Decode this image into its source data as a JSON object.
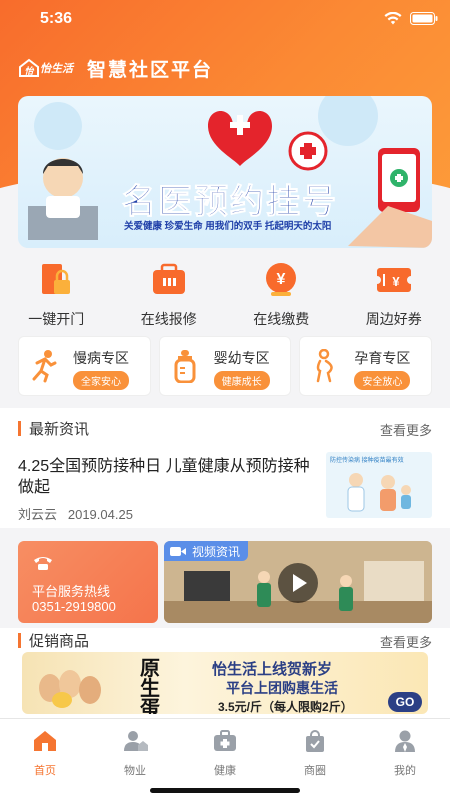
{
  "status": {
    "time": "5:36"
  },
  "app": {
    "logo_text": "怡生活",
    "title": "智慧社区平台"
  },
  "banner": {
    "headline": "名医预约挂号",
    "tagline": "关爱健康  珍爱生命  用我们的双手  托起明天的太阳"
  },
  "quick_actions": [
    {
      "label": "一键开门",
      "icon": "door-lock-icon"
    },
    {
      "label": "在线报修",
      "icon": "toolbox-icon"
    },
    {
      "label": "在线缴费",
      "icon": "yuan-coin-icon"
    },
    {
      "label": "周边好券",
      "icon": "coupon-icon"
    }
  ],
  "zones": [
    {
      "title": "慢病专区",
      "badge": "全家安心",
      "icon": "runner-icon"
    },
    {
      "title": "婴幼专区",
      "badge": "健康成长",
      "icon": "baby-bottle-icon"
    },
    {
      "title": "孕育专区",
      "badge": "安全放心",
      "icon": "pregnant-icon"
    }
  ],
  "news": {
    "heading": "最新资讯",
    "more": "查看更多",
    "item": {
      "title": "4.25全国预防接种日  儿童健康从预防接种做起",
      "author": "刘云云",
      "date": "2019.04.25",
      "thumb_caption": "防控传染病 接种疫苗最有效"
    }
  },
  "hotline": {
    "label": "平台服务热线",
    "number": "0351-2919800"
  },
  "video": {
    "tag": "视频资讯"
  },
  "promo": {
    "heading": "促销商品",
    "more": "查看更多",
    "line1": "怡生活上线贺新岁",
    "line2": "平台上团购惠生活",
    "price": "3.5元/斤（每人限购2斤）",
    "go": "GO",
    "product": "原生蛋"
  },
  "tabs": [
    {
      "label": "首页",
      "icon": "home-icon",
      "active": true
    },
    {
      "label": "物业",
      "icon": "user-house-icon",
      "active": false
    },
    {
      "label": "健康",
      "icon": "medical-kit-icon",
      "active": false
    },
    {
      "label": "商圈",
      "icon": "shopping-bag-icon",
      "active": false
    },
    {
      "label": "我的",
      "icon": "profile-icon",
      "active": false
    }
  ],
  "colors": {
    "accent": "#f57531",
    "banner_text": "#1f3fa8",
    "promo_text": "#2b3f85"
  }
}
